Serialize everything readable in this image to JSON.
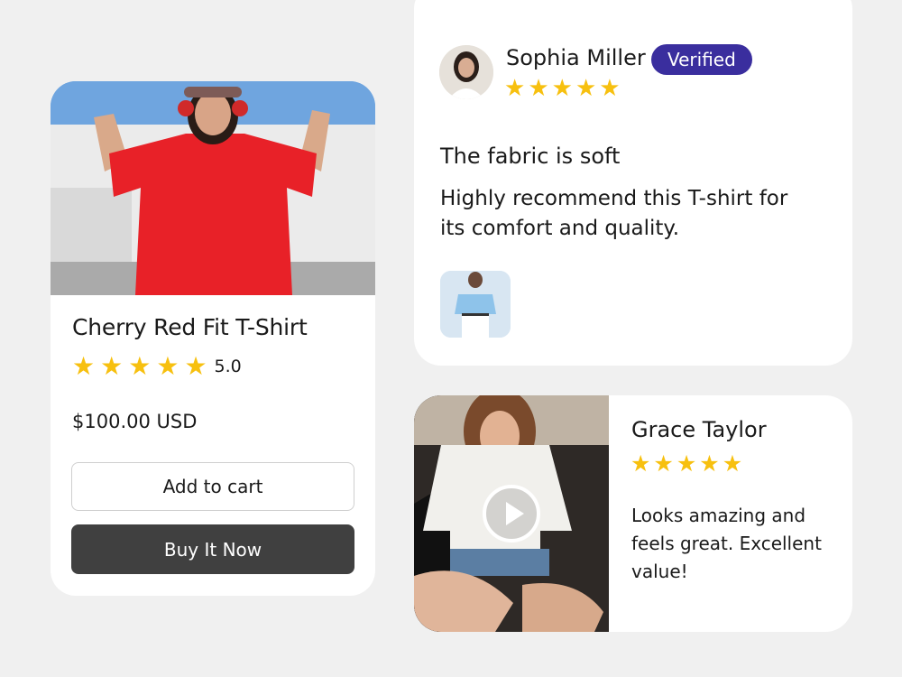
{
  "product": {
    "title": "Cherry Red Fit T-Shirt",
    "rating": 5,
    "rating_label": "5.0",
    "price": "$100.00 USD",
    "add_to_cart_label": "Add to cart",
    "buy_now_label": "Buy It Now",
    "star_color": "#f7c00f",
    "buy_button_color": "#404040"
  },
  "review": {
    "name": "Sophia Miller",
    "badge": "Verified",
    "badge_color": "#3a2e9e",
    "rating": 5,
    "title": "The fabric is soft",
    "body": "Highly recommend this T-shirt for its comfort and quality."
  },
  "video_review": {
    "name": "Grace Taylor",
    "rating": 5,
    "body": "Looks amazing and feels great. Excellent value!",
    "play_icon": "play-icon"
  }
}
